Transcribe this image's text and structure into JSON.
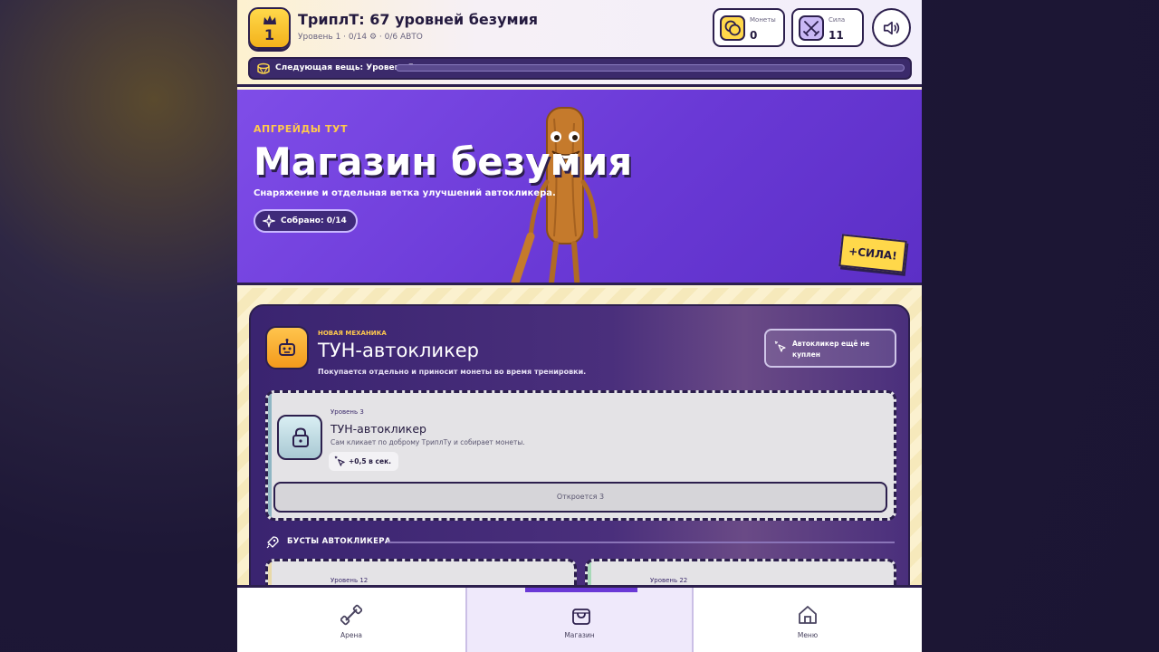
{
  "header": {
    "level": "1",
    "title": "ТриплТ: 67 уровней безумия",
    "subtitle": "Уровень 1 · 0/14 ⚙ · 0/6 АВТО",
    "coins_label": "Монеты",
    "coins_value": "0",
    "power_label": "Сила",
    "power_value": "11",
    "next_item": "Следующая вещь: Уровень 5",
    "next_progress": 0
  },
  "hero": {
    "kicker": "АПГРЕЙДЫ ТУТ",
    "title": "Магазин безумия",
    "description": "Снаряжение и отдельная ветка улучшений автокликера.",
    "collected": "Собрано: 0/14",
    "sticker": "+СИЛА!"
  },
  "autoclicker_panel": {
    "kicker": "НОВАЯ МЕХАНИКА",
    "title": "ТУН-автокликер",
    "description": "Покупается отдельно и приносит монеты во время тренировки.",
    "status": "Автокликер ещё не куплен",
    "card": {
      "level": "Уровень 3",
      "title": "ТУН-автокликер",
      "description": "Сам кликает по доброму ТриплТу и собирает монеты.",
      "rate": "+0,5 в сек.",
      "unlock": "Откроется 3"
    },
    "boosts_heading": "БУСТЫ АВТОКЛИКЕРА",
    "boosts": [
      {
        "level": "Уровень 12"
      },
      {
        "level": "Уровень 22"
      }
    ]
  },
  "nav": {
    "items": [
      {
        "label": "Арена",
        "icon": "dumbbell-icon"
      },
      {
        "label": "Магазин",
        "icon": "shopping-bag-icon"
      },
      {
        "label": "Меню",
        "icon": "home-icon"
      }
    ],
    "active": 1
  },
  "colors": {
    "accent": "#6a39d6",
    "gold": "#ffd84a",
    "dark": "#2c1f4d",
    "cream": "#fbf3d6"
  }
}
